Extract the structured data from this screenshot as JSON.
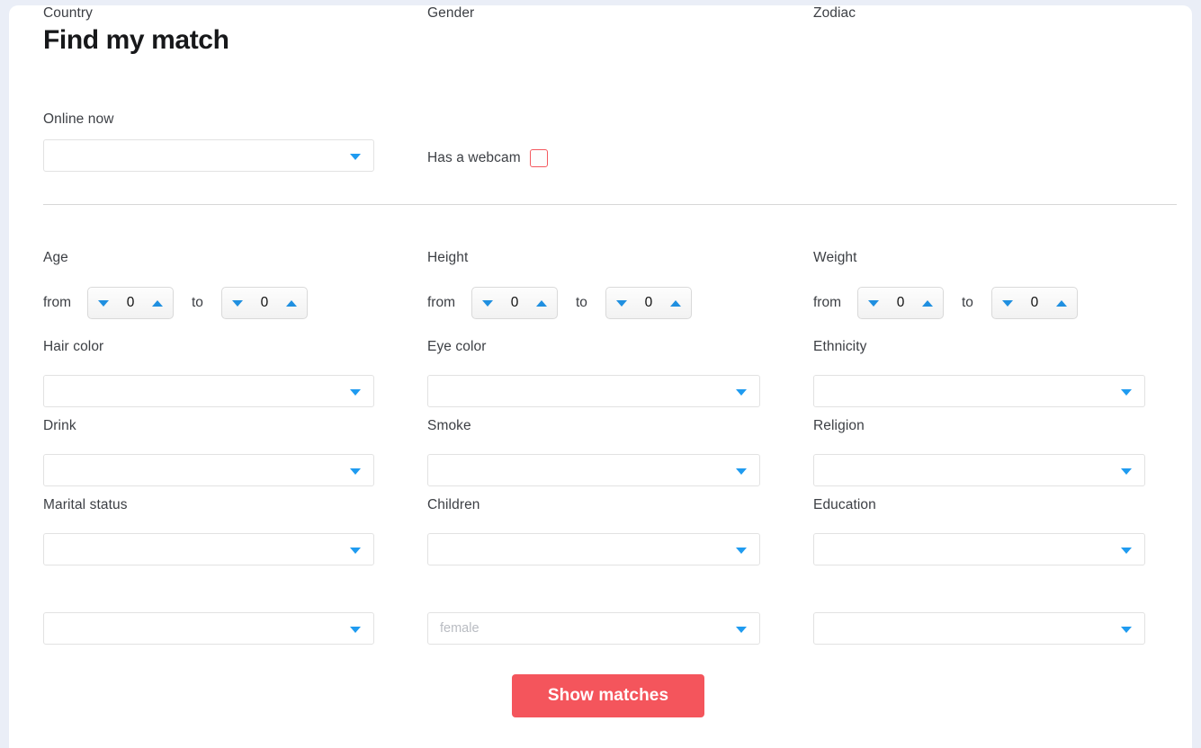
{
  "page": {
    "title": "Find my match"
  },
  "top": {
    "online_label": "Online now",
    "online_value": "",
    "webcam_label": "Has a webcam",
    "webcam_checked": false
  },
  "ranges": [
    {
      "name": "age",
      "label": "Age",
      "from_word": "from",
      "to_word": "to",
      "from_value": "0",
      "to_value": "0"
    },
    {
      "name": "height",
      "label": "Height",
      "from_word": "from",
      "to_word": "to",
      "from_value": "0",
      "to_value": "0"
    },
    {
      "name": "weight",
      "label": "Weight",
      "from_word": "from",
      "to_word": "to",
      "from_value": "0",
      "to_value": "0"
    }
  ],
  "columns": [
    {
      "name": "column-1",
      "fields": [
        {
          "name": "hair-color",
          "label": "Hair color",
          "value": ""
        },
        {
          "name": "drink",
          "label": "Drink",
          "value": ""
        },
        {
          "name": "marital-status",
          "label": "Marital status",
          "value": ""
        },
        {
          "name": "country",
          "label": "Country",
          "value": ""
        }
      ]
    },
    {
      "name": "column-2",
      "fields": [
        {
          "name": "eye-color",
          "label": "Eye color",
          "value": ""
        },
        {
          "name": "smoke",
          "label": "Smoke",
          "value": ""
        },
        {
          "name": "children",
          "label": "Children",
          "value": ""
        },
        {
          "name": "gender",
          "label": "Gender",
          "value": "female"
        }
      ]
    },
    {
      "name": "column-3",
      "fields": [
        {
          "name": "ethnicity",
          "label": "Ethnicity",
          "value": ""
        },
        {
          "name": "religion",
          "label": "Religion",
          "value": ""
        },
        {
          "name": "education",
          "label": "Education",
          "value": ""
        },
        {
          "name": "zodiac",
          "label": "Zodiac",
          "value": ""
        }
      ]
    }
  ],
  "submit": {
    "label": "Show matches"
  },
  "colors": {
    "accent_red": "#f4555c",
    "accent_blue": "#1f9bf0",
    "page_bg": "#eaeef7",
    "card_bg": "#ffffff",
    "label_text": "#3c3f44",
    "placeholder_text": "#b9bcc2"
  }
}
